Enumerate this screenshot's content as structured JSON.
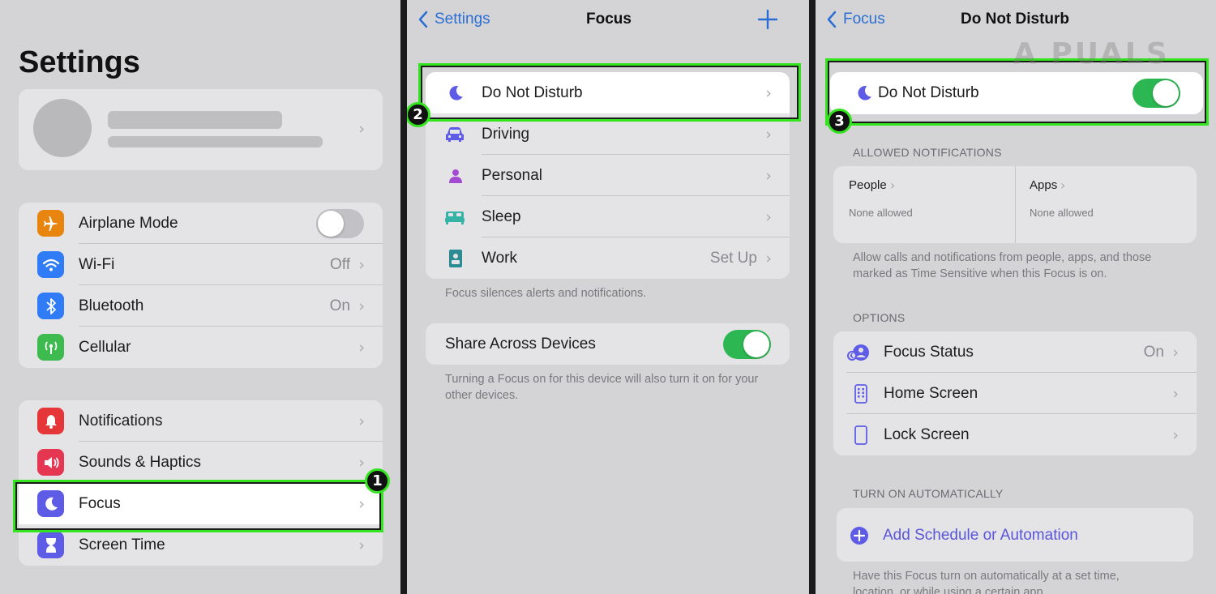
{
  "settings_panel": {
    "title": "Settings",
    "group1": [
      {
        "label": "Airplane Mode",
        "icon": "airplane-icon",
        "color": "#e8850f"
      },
      {
        "label": "Wi-Fi",
        "value": "Off",
        "icon": "wifi-icon",
        "color": "#2f7cf6"
      },
      {
        "label": "Bluetooth",
        "value": "On",
        "icon": "bluetooth-icon",
        "color": "#2f7cf6"
      },
      {
        "label": "Cellular",
        "icon": "cellular-icon",
        "color": "#3dbb4f"
      }
    ],
    "group2": [
      {
        "label": "Notifications",
        "icon": "bell-icon",
        "color": "#e5373a"
      },
      {
        "label": "Sounds & Haptics",
        "icon": "speaker-icon",
        "color": "#e53752"
      },
      {
        "label": "Focus",
        "icon": "moon-icon",
        "color": "#5e5ce6"
      },
      {
        "label": "Screen Time",
        "icon": "hourglass-icon",
        "color": "#5e5ce6"
      }
    ],
    "step": "1"
  },
  "focus_panel": {
    "back_label": "Settings",
    "title": "Focus",
    "add_icon": "plus-icon",
    "items": [
      {
        "label": "Do Not Disturb",
        "icon": "moon-icon"
      },
      {
        "label": "Driving",
        "icon": "car-icon"
      },
      {
        "label": "Personal",
        "icon": "person-icon"
      },
      {
        "label": "Sleep",
        "icon": "bed-icon"
      },
      {
        "label": "Work",
        "value": "Set Up",
        "icon": "badge-icon"
      }
    ],
    "footnote": "Focus silences alerts and notifications.",
    "share_label": "Share Across Devices",
    "share_footnote": "Turning a Focus on for this device will also turn it on for your other devices.",
    "step": "2"
  },
  "dnd_panel": {
    "back_label": "Focus",
    "title": "Do Not Disturb",
    "toggle_label": "Do Not Disturb",
    "allowed_header": "ALLOWED NOTIFICATIONS",
    "people_label": "People",
    "people_value": "None allowed",
    "apps_label": "Apps",
    "apps_value": "None allowed",
    "allowed_footnote": "Allow calls and notifications from people, apps, and those marked as Time Sensitive when this Focus is on.",
    "options_header": "OPTIONS",
    "options": [
      {
        "label": "Focus Status",
        "value": "On",
        "icon": "focus-status-icon"
      },
      {
        "label": "Home Screen",
        "icon": "phone-grid-icon"
      },
      {
        "label": "Lock Screen",
        "icon": "phone-icon"
      }
    ],
    "auto_header": "TURN ON AUTOMATICALLY",
    "add_schedule_label": "Add Schedule or Automation",
    "auto_footnote": "Have this Focus turn on automatically at a set time, location, or while using a certain app.",
    "step": "3"
  },
  "watermark": "A  PUALS",
  "colors": {
    "accent_blue": "#2a6ed4",
    "toggle_green": "#2db752",
    "highlight_green": "#33e41e",
    "focus_purple": "#5e5ce6"
  }
}
